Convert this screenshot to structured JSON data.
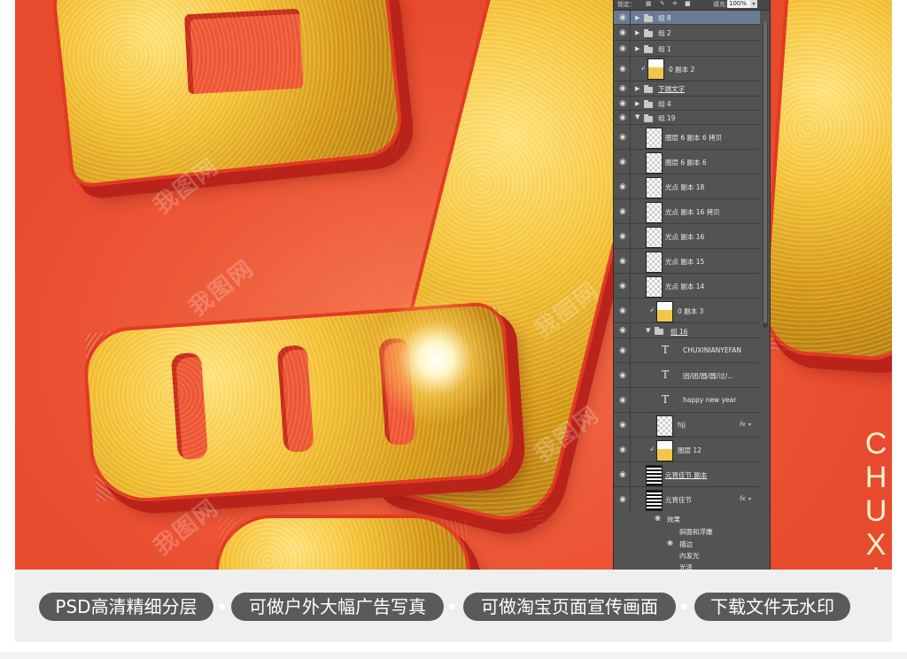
{
  "layers_panel": {
    "lock_label": "锁定：",
    "fill_label": "填充：",
    "fill_value": "100%",
    "layers": [
      {
        "name": "组 8",
        "kind": "group",
        "collapsed": true,
        "selected": true
      },
      {
        "name": "组 2",
        "kind": "group",
        "collapsed": true
      },
      {
        "name": "组 1",
        "kind": "group",
        "collapsed": true
      },
      {
        "name": "0 副本 2",
        "kind": "image",
        "clipped": true
      },
      {
        "name": "下端文字",
        "kind": "group",
        "collapsed": true
      },
      {
        "name": "组 4",
        "kind": "group",
        "collapsed": true
      },
      {
        "name": "组 19",
        "kind": "group",
        "collapsed": false
      },
      {
        "name": "图层 6 副本 6 拷贝",
        "kind": "layer"
      },
      {
        "name": "图层 6 副本 6",
        "kind": "layer"
      },
      {
        "name": "光点 副本 18",
        "kind": "layer"
      },
      {
        "name": "光点 副本 16 拷贝",
        "kind": "layer"
      },
      {
        "name": "光点 副本 16",
        "kind": "layer"
      },
      {
        "name": "光点 副本 15",
        "kind": "layer"
      },
      {
        "name": "光点 副本 14",
        "kind": "layer"
      },
      {
        "name": "0 副本 3",
        "kind": "image",
        "clipped": true
      },
      {
        "name": "组 16",
        "kind": "group",
        "collapsed": false
      },
      {
        "name": "CHUXINIANYEFAN",
        "kind": "text"
      },
      {
        "name": "团/团/圆/圆/过/...",
        "kind": "text"
      },
      {
        "name": "happy new year",
        "kind": "text"
      },
      {
        "name": "hjj",
        "kind": "layer",
        "fx": "fx"
      },
      {
        "name": "图层 12",
        "kind": "image",
        "clipped": true
      },
      {
        "name": "元宵佳节 副本",
        "kind": "image"
      },
      {
        "name": "元宵佳节",
        "kind": "image",
        "fx": "fx"
      }
    ],
    "effects": {
      "label": "效果",
      "items": [
        "斜面和浮雕",
        "描边",
        "内发光",
        "光泽"
      ]
    }
  },
  "artwork": {
    "vertical_text": "CHUXIN",
    "watermark": "我图网",
    "background_color": "#ee5a39",
    "gold_color": "#f4c23c"
  },
  "banner": {
    "features": [
      "PSD高清精细分层",
      "可做户外大幅广告写真",
      "可做淘宝页面宣传画面",
      "下载文件无水印"
    ],
    "pill_color": "#5a5a5a"
  }
}
